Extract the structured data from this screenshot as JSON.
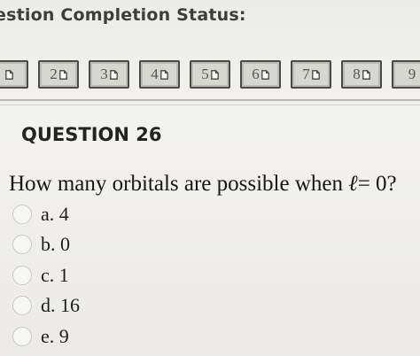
{
  "status": {
    "title": "estion Completion Status:"
  },
  "question_buttons": [
    {
      "number": ""
    },
    {
      "number": "2"
    },
    {
      "number": "3"
    },
    {
      "number": "4"
    },
    {
      "number": "5"
    },
    {
      "number": "6"
    },
    {
      "number": "7"
    },
    {
      "number": "8"
    },
    {
      "number": "9"
    }
  ],
  "question": {
    "heading": "QUESTION 26",
    "text_before": "How many orbitals are possible when ",
    "symbol": "ℓ",
    "text_after": "= 0?",
    "answers": [
      {
        "label": "a. 4",
        "selected": false
      },
      {
        "label": "b. 0",
        "selected": false
      },
      {
        "label": "c. 1",
        "selected": false
      },
      {
        "label": "d. 16",
        "selected": false
      },
      {
        "label": "e. 9",
        "selected": false
      }
    ]
  },
  "colors": {
    "background": "#efeeea",
    "button_border": "#4a4a4a",
    "button_fill": "#d7d7d2",
    "text": "#161616"
  }
}
